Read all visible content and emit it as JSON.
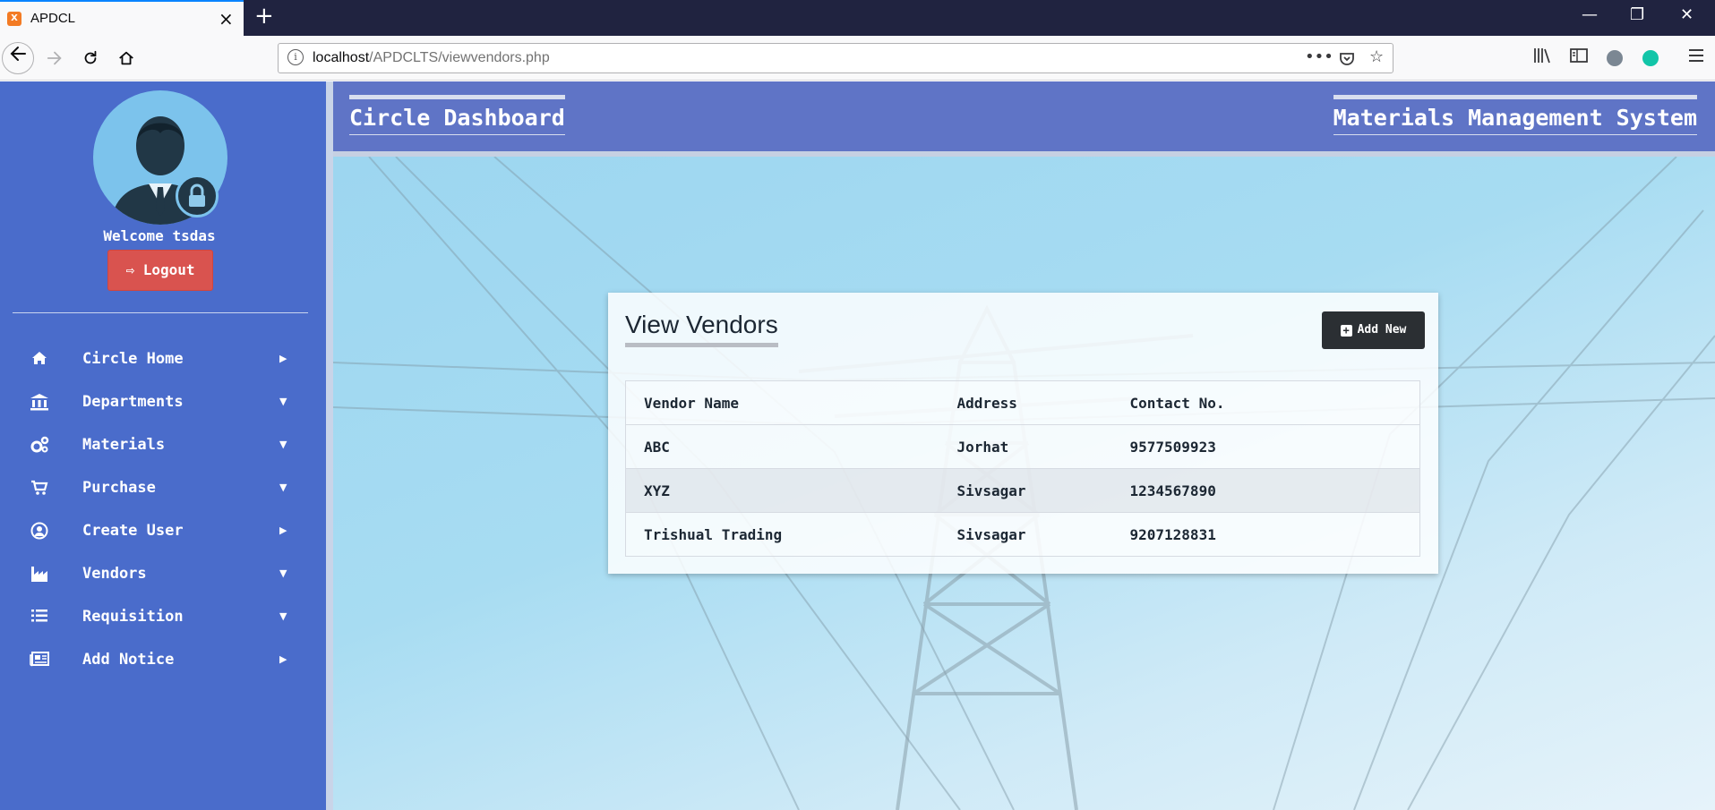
{
  "browser": {
    "tab_title": "APDCL",
    "favicon_label": "X",
    "close_tab": "×",
    "new_tab": "+",
    "url_host": "localhost",
    "url_path": "/APDCLTS/viewvendors.php",
    "window_controls": [
      "—",
      "❐",
      "✕"
    ],
    "icons": [
      "back-arrow-icon",
      "forward-arrow-icon",
      "reload-icon",
      "home-icon",
      "info-icon",
      "more-icon",
      "pocket-icon",
      "star-icon",
      "library-icon",
      "sidebar-icon",
      "account-icon",
      "extension-icon",
      "menu-icon"
    ]
  },
  "sidebar": {
    "welcome": "Welcome tsdas",
    "logout_label": "Logout",
    "items": [
      {
        "label": "Circle Home",
        "icon": "home-icon",
        "caret": "right"
      },
      {
        "label": "Departments",
        "icon": "bank-icon",
        "caret": "down"
      },
      {
        "label": "Materials",
        "icon": "gears-icon",
        "caret": "down"
      },
      {
        "label": "Purchase",
        "icon": "cart-icon",
        "caret": "down"
      },
      {
        "label": "Create User",
        "icon": "user-circle-icon",
        "caret": "right"
      },
      {
        "label": "Vendors",
        "icon": "industry-icon",
        "caret": "down"
      },
      {
        "label": "Requisition",
        "icon": "list-icon",
        "caret": "down"
      },
      {
        "label": "Add Notice",
        "icon": "newspaper-icon",
        "caret": "right"
      }
    ]
  },
  "header": {
    "left_title": "Circle Dashboard",
    "right_title": "Materials Management System"
  },
  "main": {
    "panel_title": "View Vendors",
    "add_button_label": "Add New",
    "table": {
      "columns": [
        "Vendor Name",
        "Address",
        "Contact No."
      ],
      "rows": [
        [
          "ABC",
          "Jorhat",
          "9577509923"
        ],
        [
          "XYZ",
          "Sivsagar",
          "1234567890"
        ],
        [
          "Trishual Trading",
          "Sivsagar",
          "9207128831"
        ]
      ]
    }
  },
  "colors": {
    "sidebar": "#4a6ccb",
    "header": "#5f74c6",
    "logout": "#d9534f",
    "add_button": "#2b2f33"
  }
}
